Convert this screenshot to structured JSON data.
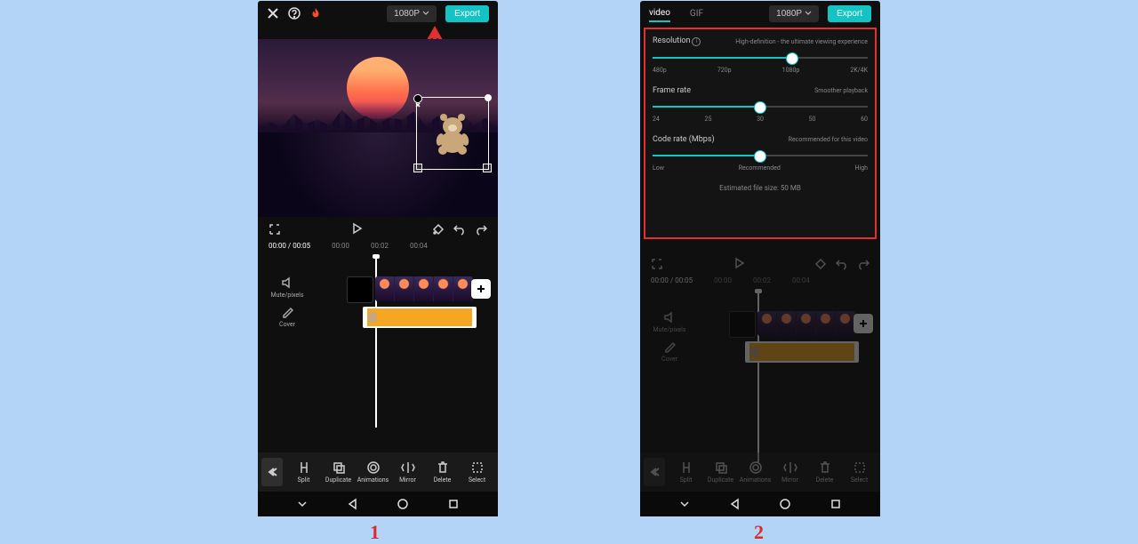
{
  "labels": {
    "one": "1",
    "two": "2"
  },
  "topbar": {
    "resolution": "1080P",
    "export": "Export",
    "tabs": {
      "video": "video",
      "gif": "GIF"
    }
  },
  "timecodes": {
    "cur": "00:00",
    "dur": "00:05",
    "t1": "00:00",
    "t2": "00:02",
    "t3": "00:04"
  },
  "timeline": {
    "mute": "Mute/pixels",
    "cover": "Cover"
  },
  "tools": {
    "split": "Split",
    "duplicate": "Duplicate",
    "animations": "Animations",
    "mirror": "Mirror",
    "delete": "Delete",
    "select": "Select"
  },
  "settings": {
    "resolution": {
      "label": "Resolution",
      "hint": "High-definition - the ultimate viewing experience",
      "ticks": [
        "480p",
        "720p",
        "1080p",
        "2K/4K"
      ],
      "fill": 65
    },
    "framerate": {
      "label": "Frame rate",
      "hint": "Smoother playback",
      "ticks": [
        "24",
        "25",
        "30",
        "50",
        "60"
      ],
      "fill": 50
    },
    "coderate": {
      "label": "Code rate (Mbps)",
      "hint": "Recommended for this video",
      "ticks": [
        "Low",
        "Recommended",
        "High"
      ],
      "fill": 50
    },
    "estimate": "Estimated file size: 50 MB"
  },
  "chart_data": {
    "type": "table",
    "sliders": [
      {
        "name": "Resolution",
        "options": [
          "480p",
          "720p",
          "1080p",
          "2K/4K"
        ],
        "value": "1080p"
      },
      {
        "name": "Frame rate",
        "options": [
          24,
          25,
          30,
          50,
          60
        ],
        "value": 30
      },
      {
        "name": "Code rate (Mbps)",
        "options": [
          "Low",
          "Recommended",
          "High"
        ],
        "value": "Recommended"
      }
    ]
  }
}
